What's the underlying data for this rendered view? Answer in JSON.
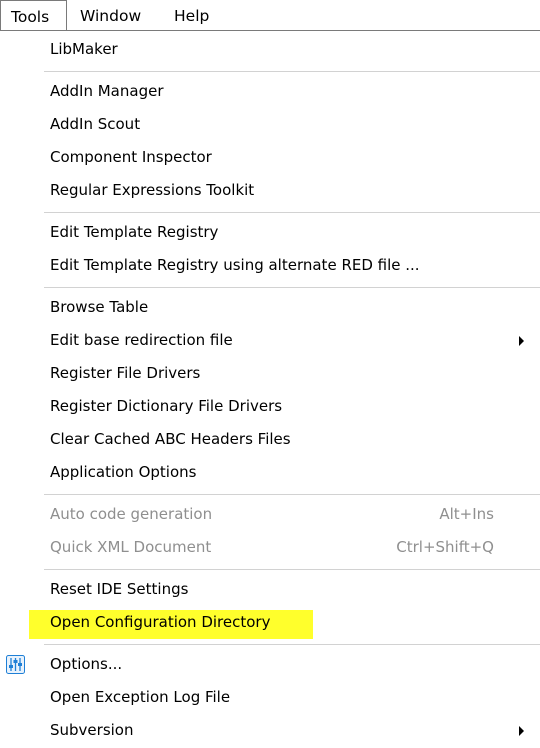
{
  "menubar": {
    "items": [
      {
        "label": "Tools"
      },
      {
        "label": "Window"
      },
      {
        "label": "Help"
      }
    ]
  },
  "menu": {
    "libmaker": "LibMaker",
    "addin_manager": "AddIn Manager",
    "addin_scout": "AddIn Scout",
    "component_inspector": "Component Inspector",
    "regex_toolkit": "Regular Expressions Toolkit",
    "edit_template_registry": "Edit Template Registry",
    "edit_template_registry_alt": "Edit Template Registry using alternate RED file ...",
    "browse_table": "Browse Table",
    "edit_base_redirection": "Edit base redirection file",
    "register_file_drivers": "Register File Drivers",
    "register_dictionary_drivers": "Register Dictionary File Drivers",
    "clear_cached_abc": "Clear Cached ABC Headers Files",
    "application_options": "Application Options",
    "auto_code_generation": "Auto code generation",
    "auto_code_generation_shortcut": "Alt+Ins",
    "quick_xml_document": "Quick XML Document",
    "quick_xml_document_shortcut": "Ctrl+Shift+Q",
    "reset_ide_settings": "Reset IDE Settings",
    "open_config_directory": "Open Configuration Directory",
    "options": "Options...",
    "open_exception_log": "Open Exception Log File",
    "subversion": "Subversion"
  },
  "colors": {
    "highlight": "#ffff2c",
    "disabled_text": "#8f8f8f",
    "options_icon": "#1e7fd6"
  },
  "icons": {
    "options": "settings-sliders-icon",
    "submenu": "chevron-right-icon"
  }
}
